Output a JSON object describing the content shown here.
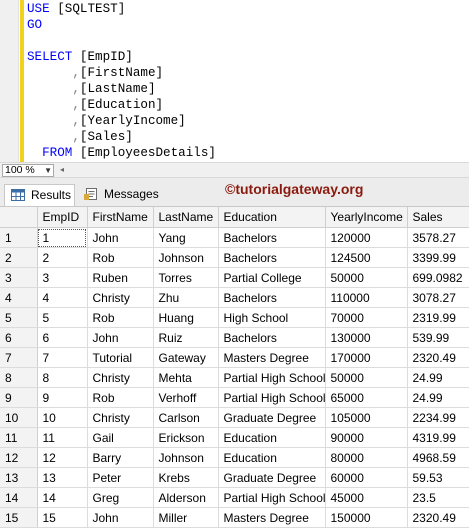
{
  "editor": {
    "lines": [
      [
        {
          "t": "USE ",
          "c": "kw"
        },
        {
          "t": "[SQLTEST]",
          "c": "txt"
        }
      ],
      [
        {
          "t": "GO",
          "c": "kw"
        }
      ],
      [],
      [
        {
          "t": "SELECT ",
          "c": "kw"
        },
        {
          "t": "[EmpID]",
          "c": "txt"
        }
      ],
      [
        {
          "t": "      ",
          "c": "txt"
        },
        {
          "t": ",",
          "c": "punct"
        },
        {
          "t": "[FirstName]",
          "c": "txt"
        }
      ],
      [
        {
          "t": "      ",
          "c": "txt"
        },
        {
          "t": ",",
          "c": "punct"
        },
        {
          "t": "[LastName]",
          "c": "txt"
        }
      ],
      [
        {
          "t": "      ",
          "c": "txt"
        },
        {
          "t": ",",
          "c": "punct"
        },
        {
          "t": "[Education]",
          "c": "txt"
        }
      ],
      [
        {
          "t": "      ",
          "c": "txt"
        },
        {
          "t": ",",
          "c": "punct"
        },
        {
          "t": "[YearlyIncome]",
          "c": "txt"
        }
      ],
      [
        {
          "t": "      ",
          "c": "txt"
        },
        {
          "t": ",",
          "c": "punct"
        },
        {
          "t": "[Sales]",
          "c": "txt"
        }
      ],
      [
        {
          "t": "  FROM ",
          "c": "kw"
        },
        {
          "t": "[EmployeesDetails]",
          "c": "txt"
        }
      ]
    ]
  },
  "statusbar": {
    "zoom": "100 %"
  },
  "tabs": {
    "results": "Results",
    "messages": "Messages"
  },
  "watermark": "©tutorialgateway.org",
  "grid": {
    "columns": [
      "",
      "EmpID",
      "FirstName",
      "LastName",
      "Education",
      "YearlyIncome",
      "Sales"
    ],
    "rows": [
      [
        "1",
        "1",
        "John",
        "Yang",
        "Bachelors",
        "120000",
        "3578.27"
      ],
      [
        "2",
        "2",
        "Rob",
        "Johnson",
        "Bachelors",
        "124500",
        "3399.99"
      ],
      [
        "3",
        "3",
        "Ruben",
        "Torres",
        "Partial College",
        "50000",
        "699.0982"
      ],
      [
        "4",
        "4",
        "Christy",
        "Zhu",
        "Bachelors",
        "110000",
        "3078.27"
      ],
      [
        "5",
        "5",
        "Rob",
        "Huang",
        "High School",
        "70000",
        "2319.99"
      ],
      [
        "6",
        "6",
        "John",
        "Ruiz",
        "Bachelors",
        "130000",
        "539.99"
      ],
      [
        "7",
        "7",
        "Tutorial",
        "Gateway",
        "Masters Degree",
        "170000",
        "2320.49"
      ],
      [
        "8",
        "8",
        "Christy",
        "Mehta",
        "Partial High School",
        "50000",
        "24.99"
      ],
      [
        "9",
        "9",
        "Rob",
        "Verhoff",
        "Partial High School",
        "65000",
        "24.99"
      ],
      [
        "10",
        "10",
        "Christy",
        "Carlson",
        "Graduate Degree",
        "105000",
        "2234.99"
      ],
      [
        "11",
        "11",
        "Gail",
        "Erickson",
        "Education",
        "90000",
        "4319.99"
      ],
      [
        "12",
        "12",
        "Barry",
        "Johnson",
        "Education",
        "80000",
        "4968.59"
      ],
      [
        "13",
        "13",
        "Peter",
        "Krebs",
        "Graduate Degree",
        "60000",
        "59.53"
      ],
      [
        "14",
        "14",
        "Greg",
        "Alderson",
        "Partial High School",
        "45000",
        "23.5"
      ],
      [
        "15",
        "15",
        "John",
        "Miller",
        "Masters Degree",
        "150000",
        "2320.49"
      ]
    ]
  }
}
